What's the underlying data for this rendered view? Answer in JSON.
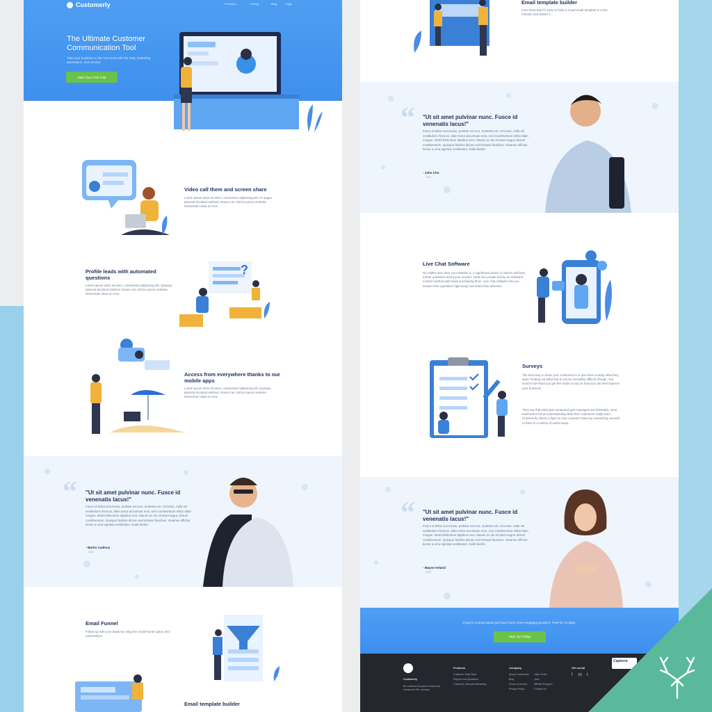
{
  "brand": {
    "name": "Customerly"
  },
  "nav": {
    "items": [
      "Products ⌄",
      "Pricing",
      "Blog",
      "Login"
    ]
  },
  "hero": {
    "title": "The Ultimate Customer Communication Tool",
    "subtitle": "Take your business to the next level with live chat, marketing automation, and surveys",
    "cta": "Start Your Free Trial"
  },
  "features_left": [
    {
      "title": "Video call them and screen share",
      "body": "Lorem ipsum dolor sit amet, consectetur adipiscing elit. Ut augue placerat tincidunt eleifend. Donec nec nisl leo purus molestie elementum vitae ac eros."
    },
    {
      "title": "Profile leads with automated questions",
      "body": "Lorem ipsum dolor sit amet, consectetur adipiscing elit. Quisque placerat tincidunt eleifend. Donec nec nisl leo purus molestie elementum vitae ac eros."
    },
    {
      "title": "Access from everywhere thanks to our mobile apps",
      "body": "Lorem ipsum dolor sit amet, consectetur adipiscing elit. Quisque placerat tincidunt eleifend. Donec nec nisl leo purus molestie elementum vitae ac eros."
    },
    {
      "title": "Email Funnel",
      "body": "Follow up with your leads by using the email funnel option and automations."
    },
    {
      "title": "Email template builder",
      "body": ""
    }
  ],
  "features_right": [
    {
      "title": "Email template builder",
      "body": "Let's show that it's easy to build a visual email template in a few minutes and deliver it."
    },
    {
      "title": "Live Chat Software",
      "body": "No matter how clear your website is, a significant portion of visitors will have further questions about your product. Have live people having an awkward contact method with leads purchasing them. Live chat software lets you answer their questions right away and retain their attention."
    },
    {
      "title": "Surveys",
      "body": "The best way to serve your customers is to give them exactly what they want. Finding out what that is can be incredibly difficult, though. Our survey tool helps you get the inside scoop on how you can best improve your business.",
      "body2": "They say that what gets measured gets managed and ultimately, most businesses fail at understanding what their customers really want. Customerly shines a light on your customer base by connecting yourself to them in a variety of useful ways."
    }
  ],
  "testimonials": [
    {
      "title": "\"Ut sit amet pulvinar nunc. Fusce id venenatis lacus!\"",
      "body": "Fusce id tellus accumsan, porttitor est non, molestie est. Ut luctus, nulla vel vestibulum rhoncus, diam tortor accumsan eros, non condimentum tellus diam congue. Morbi bibendum dapibus eros. Mauris ac dui sit amet augue dictum condimentum. Quisque facilisis dictum sed tempus faucibus. Vivamus efficitur lectus a urna egestas vestibulum. Nulla facilisi.",
      "name": "- Martin Cadmus",
      "role": "CEO"
    },
    {
      "title": "\"Ut sit amet pulvinar nunc. Fusce id venenatis lacus!\"",
      "body": "Fusce id tellus accumsan, porttitor est non, molestie est. Ut luctus, nulla vel vestibulum rhoncus, diam tortor accumsan eros, non condimentum tellus diam congue. Morbi bibendum dapibus eros. Mauris ac dui sit amet augue dictum condimentum. Quisque facilisis dictum sed tempus faucibus. Vivamus efficitur lectus a urna egestas vestibulum. Nulla facilisi.",
      "name": "- John Cho",
      "role": "CEO"
    },
    {
      "title": "\"Ut sit amet pulvinar nunc. Fusce id venenatis lacus!\"",
      "body": "Fusce id tellus accumsan, porttitor est non, molestie est. Ut luctus, nulla vel vestibulum rhoncus, diam tortor accumsan eros, non condimentum tellus diam congue. Morbi bibendum dapibus eros. Mauris ac dui sit amet augue dictum condimentum. Quisque facilisis dictum sed tempus faucibus. Vivamus efficitur lectus a urna egestas vestibulum. Nulla facilisi.",
      "name": "- Mayne Ireland",
      "role": "CEO"
    }
  ],
  "cta_band": {
    "text": "If you're curious about just how much more engaging people's. Free for 14 days.",
    "button": "Sign Up Today"
  },
  "footer": {
    "brand": "Customerly",
    "tagline": "Be customer focused, it improves everyone's life, promise.",
    "cols": [
      {
        "h": "Products",
        "links": [
          "Customer Help Desk",
          "Support and Quotation",
          "Customer Lifecycle Marketing"
        ]
      },
      {
        "h": "Company",
        "links": [
          "About Customerly",
          "Blog",
          "Terms of service",
          "Privacy Policy"
        ]
      },
      {
        "h": "",
        "links": [
          "Help Center",
          "Jobs",
          "Affiliate Program",
          "Contact Us"
        ]
      },
      {
        "h": "Get social",
        "links": []
      }
    ],
    "social": [
      "f",
      "in",
      "t"
    ],
    "badge": "Capterra"
  },
  "colors": {
    "hero": "#4d9ef2",
    "cta_green": "#6bc24a",
    "navy": "#21325b",
    "footer": "#24272d",
    "corner": "#5ab99b"
  }
}
